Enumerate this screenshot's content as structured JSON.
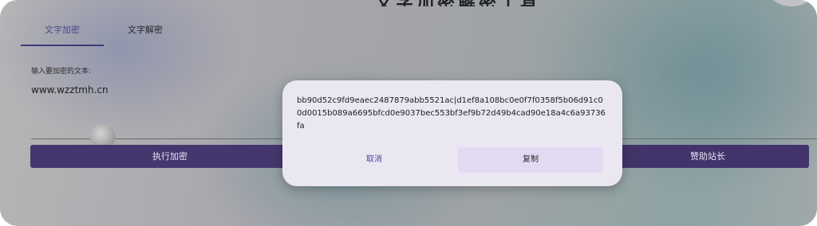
{
  "header": {
    "title_fragment": "文字加密解密工具"
  },
  "tabs": [
    {
      "label": "文字加密",
      "active": true
    },
    {
      "label": "文字解密",
      "active": false
    }
  ],
  "input": {
    "label": "输入要加密的文本:",
    "value": "www.wzztmh.cn"
  },
  "buttons": {
    "encrypt_label": "执行加密",
    "sponsor_label": "赞助站长"
  },
  "dialog": {
    "result": "bb90d52c9fd9eaec2487879abb5521ac|d1ef8a108bc0e0f7f0358f5b06d91c00d0015b089a6695bfcd0e9037bec553bf3ef9b72d49b4cad90e18a4c6a93736fa",
    "cancel_label": "取消",
    "copy_label": "复制"
  },
  "colors": {
    "primary_button": "#45376d",
    "tab_indicator": "#3e3a7a",
    "dialog_bg": "#ebe7f2",
    "accent_text": "#4c45a0"
  }
}
